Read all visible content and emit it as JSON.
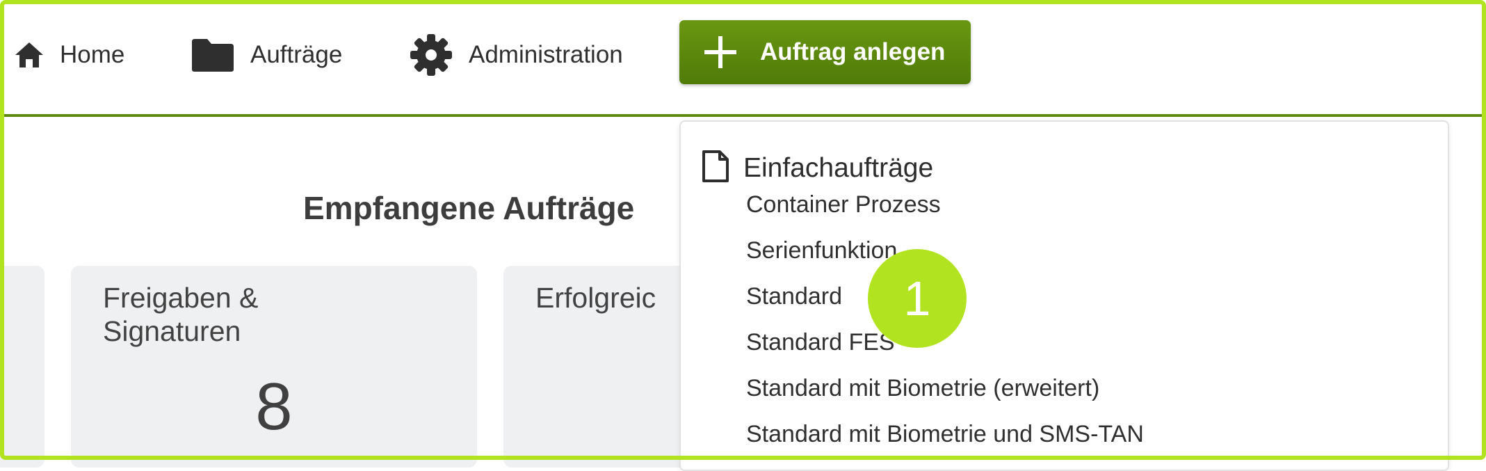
{
  "nav": {
    "home_label": "Home",
    "orders_label": "Aufträge",
    "admin_label": "Administration",
    "create_label": "Auftrag anlegen"
  },
  "dashboard": {
    "section_title": "Empfangene Aufträge",
    "approvals_card_title": "Freigaben & Signaturen",
    "approvals_count": "8",
    "success_card_title": "Erfolgreic"
  },
  "dropdown": {
    "group_label": "Einfachaufträge",
    "items": [
      "Container Prozess",
      "Serienfunktion",
      "Standard",
      "Standard FES",
      "Standard mit Biometrie (erweitert)",
      "Standard mit Biometrie und SMS-TAN"
    ]
  },
  "callout": {
    "number": "1",
    "color": "#b2e320"
  },
  "colors": {
    "accent": "#b2e320",
    "button": "#5e8a0f"
  }
}
